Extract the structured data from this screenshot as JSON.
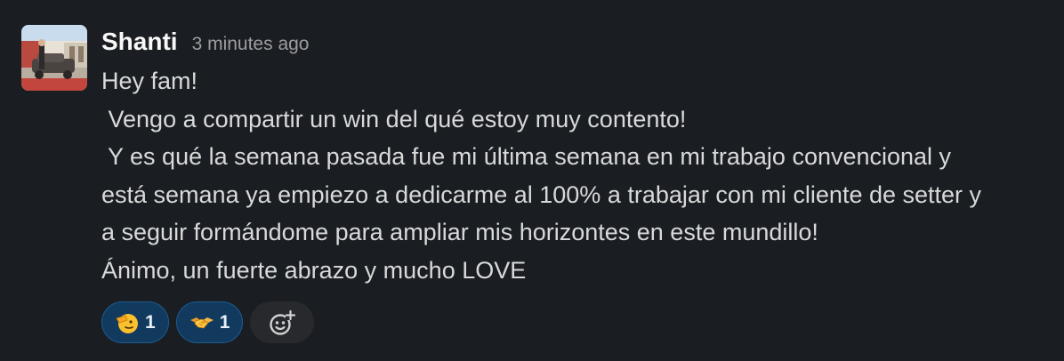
{
  "message": {
    "author": "Shanti",
    "timestamp": "3 minutes ago",
    "lines": [
      "Hey fam!",
      " Vengo a compartir un win del qué estoy muy contento!",
      " Y es qué la semana pasada fue mi última semana en mi trabajo convencional y",
      "está semana ya empiezo a dedicarme al 100% a trabajar con mi cliente de setter y",
      "a seguir formándome para ampliar mis horizontes en este mundillo!",
      "Ánimo, un fuerte abrazo y mucho LOVE"
    ]
  },
  "reactions": [
    {
      "emoji": "saluting-face-icon",
      "count": "1"
    },
    {
      "emoji": "handshake-icon",
      "count": "1"
    }
  ],
  "add_reaction": {
    "icon": "add-emoji-icon"
  },
  "colors": {
    "background": "#1a1d21",
    "reaction_bg": "#123a5e",
    "reaction_border": "#1d5b91",
    "add_reaction_bg": "#27292d",
    "text": "#d8d9da",
    "timestamp": "#9c9da0"
  }
}
